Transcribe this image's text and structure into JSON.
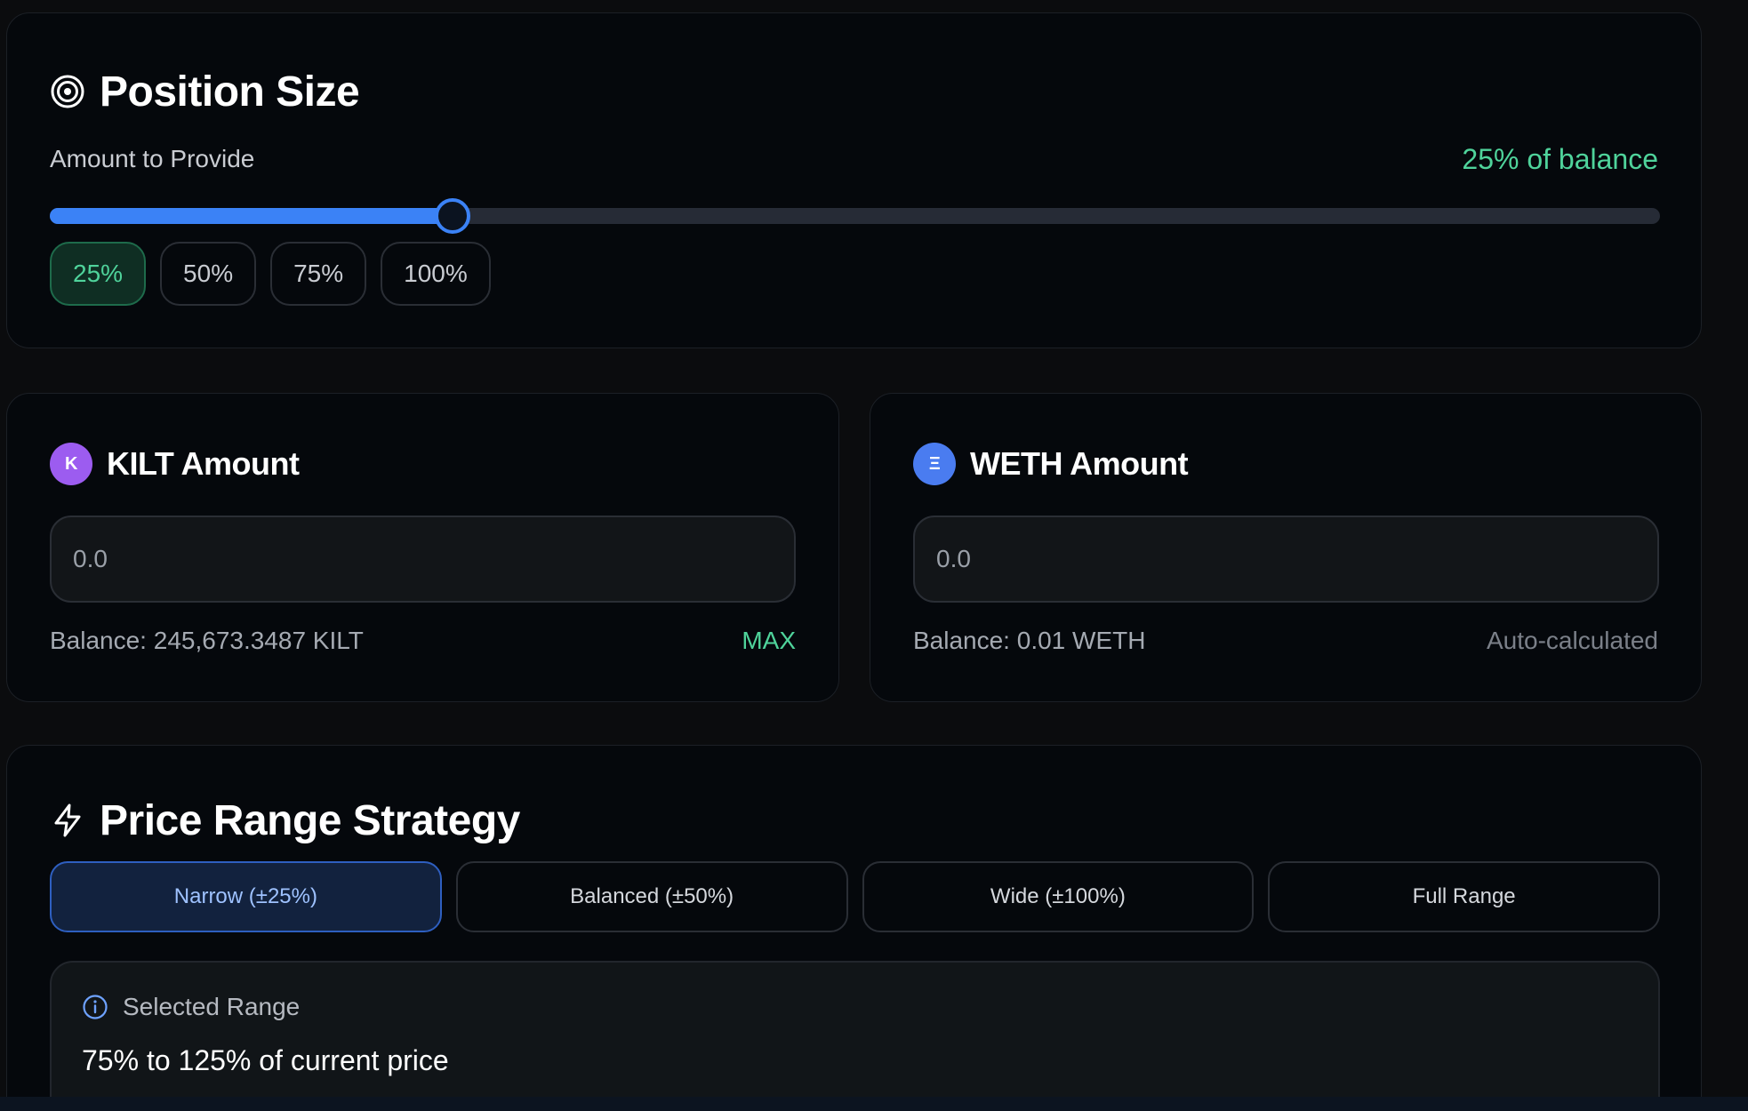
{
  "colors": {
    "accent_green": "#4fd39b",
    "accent_blue": "#3b82f6",
    "kilt_badge": "#9c5cf0",
    "weth_badge": "#4a7cf0"
  },
  "position_size": {
    "icon": "target-icon",
    "title": "Position Size",
    "amount_label": "Amount to Provide",
    "balance_percent_text": "25% of balance",
    "slider_value_percent": 25,
    "buttons": [
      {
        "label": "25%",
        "active": true
      },
      {
        "label": "50%",
        "active": false
      },
      {
        "label": "75%",
        "active": false
      },
      {
        "label": "100%",
        "active": false
      }
    ]
  },
  "kilt": {
    "badge": "K",
    "title": "KILT Amount",
    "input_placeholder": "0.0",
    "balance": "Balance: 245,673.3487 KILT",
    "max_label": "MAX"
  },
  "weth": {
    "badge": "Ξ",
    "title": "WETH Amount",
    "input_placeholder": "0.0",
    "balance": "Balance: 0.01 WETH",
    "auto_label": "Auto-calculated"
  },
  "price_range": {
    "icon": "lightning-icon",
    "title": "Price Range Strategy",
    "strategies": [
      {
        "label": "Narrow (±25%)",
        "active": true
      },
      {
        "label": "Balanced (±50%)",
        "active": false
      },
      {
        "label": "Wide (±100%)",
        "active": false
      },
      {
        "label": "Full Range",
        "active": false
      }
    ],
    "selected_label": "Selected Range",
    "selected_value": "75% to 125% of current price"
  }
}
